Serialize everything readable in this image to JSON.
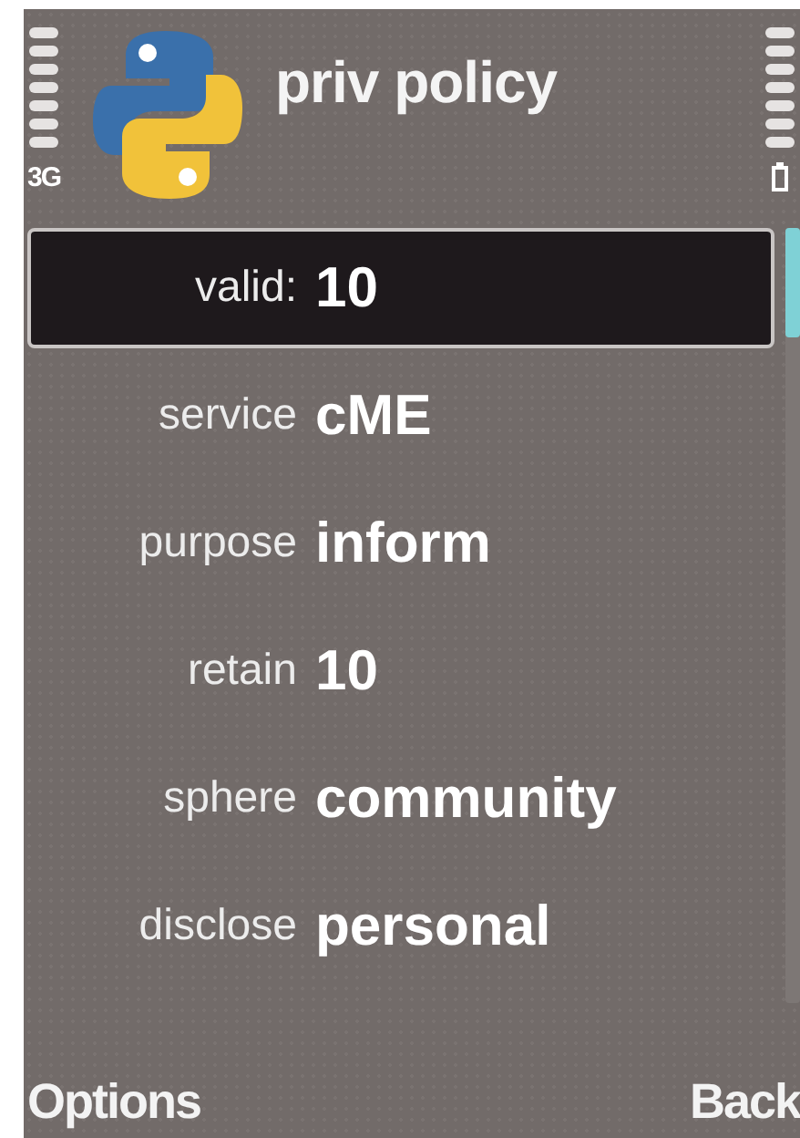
{
  "status_bar": {
    "network": "3G"
  },
  "title": "priv policy",
  "fields": [
    {
      "label": "valid:",
      "value": "10",
      "selected": true
    },
    {
      "label": "service",
      "value": "cME",
      "selected": false
    },
    {
      "label": "purpose",
      "value": "inform",
      "selected": false
    },
    {
      "label": "retain",
      "value": "10",
      "selected": false
    },
    {
      "label": "sphere",
      "value": "community",
      "selected": false
    },
    {
      "label": "disclose",
      "value": "personal",
      "selected": false
    }
  ],
  "softkeys": {
    "left": "Options",
    "right": "Back"
  }
}
